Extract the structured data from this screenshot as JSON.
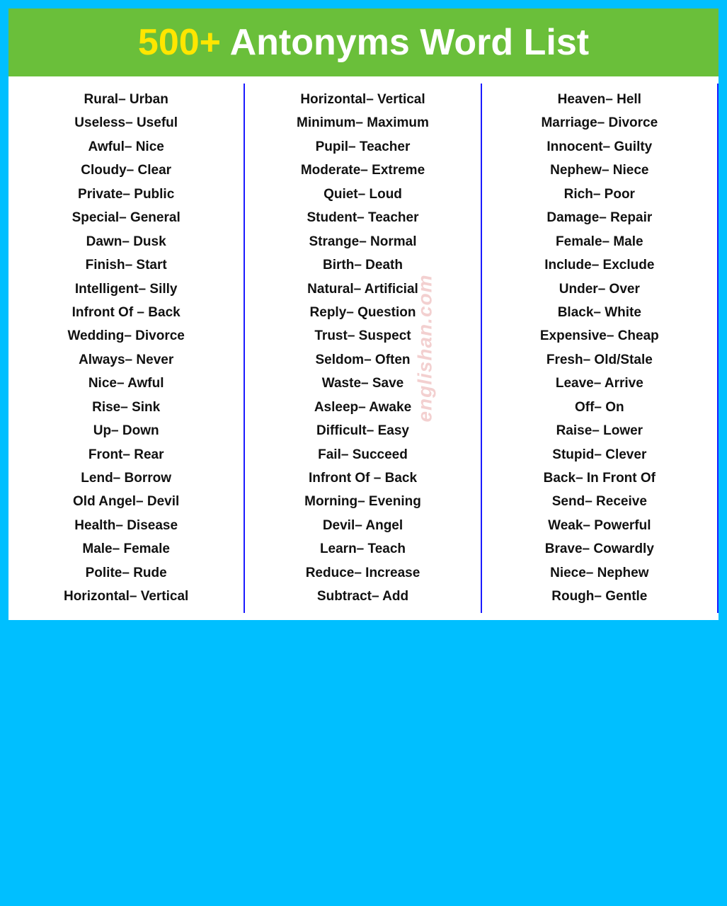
{
  "header": {
    "number": "500+",
    "title": "Antonyms Word List"
  },
  "watermark": "englishan.com",
  "columns": [
    {
      "id": "col1",
      "pairs": [
        "Rural– Urban",
        "Useless– Useful",
        "Awful– Nice",
        "Cloudy– Clear",
        "Private– Public",
        "Special– General",
        "Dawn– Dusk",
        "Finish– Start",
        "Intelligent– Silly",
        "Infront Of – Back",
        "Wedding– Divorce",
        "Always– Never",
        "Nice– Awful",
        "Rise– Sink",
        "Up– Down",
        "Front– Rear",
        "Lend– Borrow",
        "Old Angel– Devil",
        "Health– Disease",
        "Male– Female",
        "Polite– Rude",
        "Horizontal– Vertical"
      ]
    },
    {
      "id": "col2",
      "pairs": [
        "Horizontal– Vertical",
        "Minimum– Maximum",
        "Pupil– Teacher",
        "Moderate– Extreme",
        "Quiet– Loud",
        "Student– Teacher",
        "Strange– Normal",
        "Birth– Death",
        "Natural– Artificial",
        "Reply– Question",
        "Trust– Suspect",
        "Seldom– Often",
        "Waste– Save",
        "Asleep– Awake",
        "Difficult– Easy",
        "Fail– Succeed",
        "Infront Of – Back",
        "Morning– Evening",
        "Devil– Angel",
        "Learn– Teach",
        "Reduce– Increase",
        "Subtract– Add"
      ]
    },
    {
      "id": "col3",
      "pairs": [
        "Heaven– Hell",
        "Marriage– Divorce",
        "Innocent– Guilty",
        "Nephew– Niece",
        "Rich– Poor",
        "Damage– Repair",
        "Female– Male",
        "Include– Exclude",
        "Under– Over",
        "Black– White",
        "Expensive– Cheap",
        "Fresh– Old/Stale",
        "Leave– Arrive",
        "Off– On",
        "Raise– Lower",
        "Stupid– Clever",
        "Back– In Front Of",
        "Send– Receive",
        "Weak– Powerful",
        "Brave– Cowardly",
        "Niece– Nephew",
        "Rough– Gentle"
      ]
    }
  ]
}
